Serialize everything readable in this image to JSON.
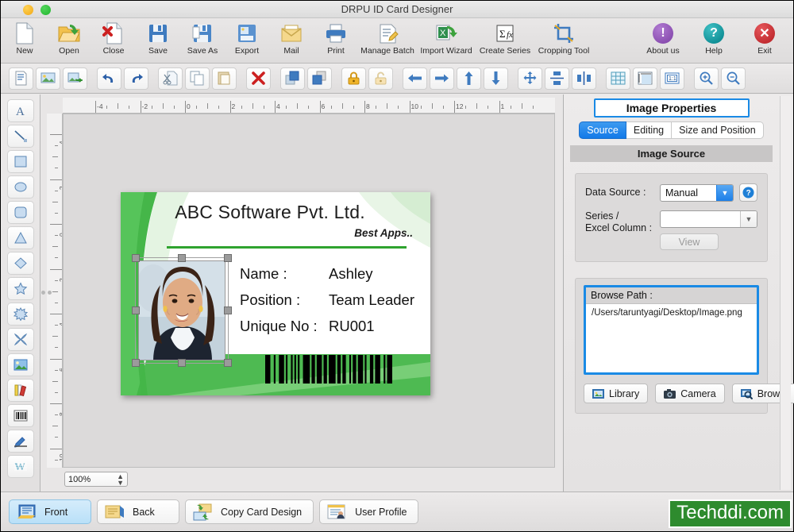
{
  "window": {
    "title": "DRPU ID Card Designer"
  },
  "main_toolbar": {
    "items": [
      {
        "label": "New",
        "icon": "new-document-icon"
      },
      {
        "label": "Open",
        "icon": "open-folder-icon"
      },
      {
        "label": "Close",
        "icon": "close-document-icon"
      },
      {
        "label": "Save",
        "icon": "save-disk-icon"
      },
      {
        "label": "Save As",
        "icon": "save-as-icon"
      },
      {
        "label": "Export",
        "icon": "export-icon"
      },
      {
        "label": "Mail",
        "icon": "mail-icon"
      },
      {
        "label": "Print",
        "icon": "printer-icon"
      },
      {
        "label": "Manage Batch",
        "icon": "manage-batch-icon"
      },
      {
        "label": "Import Wizard",
        "icon": "import-wizard-icon"
      },
      {
        "label": "Create Series",
        "icon": "create-series-icon"
      },
      {
        "label": "Cropping Tool",
        "icon": "cropping-tool-icon"
      }
    ],
    "right_items": [
      {
        "label": "About us",
        "icon": "info-circle-icon",
        "color": "#7d3fa5",
        "glyph": "!"
      },
      {
        "label": "Help",
        "icon": "help-circle-icon",
        "color": "#007e86",
        "glyph": "?"
      },
      {
        "label": "Exit",
        "icon": "exit-circle-icon",
        "color": "#b51d22",
        "glyph": "✕"
      }
    ]
  },
  "sub_toolbar": {
    "items": [
      "add-text-icon",
      "add-image-icon",
      "add-image-export-icon",
      "undo-icon",
      "redo-icon",
      "cut-icon",
      "copy-icon",
      "paste-icon",
      "delete-icon",
      "bring-to-front-icon",
      "send-to-back-icon",
      "lock-icon",
      "unlock-icon",
      "align-left-icon",
      "align-right-icon",
      "align-top-icon",
      "align-bottom-icon",
      "center-both-icon",
      "center-vertical-icon",
      "center-horizontal-icon",
      "grid-icon",
      "ruler-icon",
      "actual-size-icon",
      "zoom-in-icon",
      "zoom-out-icon"
    ]
  },
  "left_rail": {
    "tools": [
      "text-tool-icon",
      "line-tool-icon",
      "rectangle-tool-icon",
      "ellipse-tool-icon",
      "rounded-rectangle-tool-icon",
      "triangle-tool-icon",
      "diamond-tool-icon",
      "star-tool-icon",
      "burst-tool-icon",
      "four-point-star-tool-icon",
      "image-tool-icon",
      "signature-book-tool-icon",
      "barcode-tool-icon",
      "pen-tool-icon",
      "watermark-tool-icon"
    ]
  },
  "canvas": {
    "zoom_level": "100%",
    "ruler_h_labels": [
      "-4",
      "-2",
      "0",
      "2",
      "4",
      "6",
      "8",
      "10",
      "12",
      "1"
    ],
    "ruler_v_labels": [
      "-4",
      "-2",
      "0",
      "2",
      "4",
      "6",
      "8",
      "10"
    ]
  },
  "card": {
    "company_title": "ABC Software Pvt. Ltd.",
    "tagline": "Best Apps..",
    "fields": [
      {
        "label": "Name :",
        "value": "Ashley"
      },
      {
        "label": "Position :",
        "value": "Team Leader"
      },
      {
        "label": "Unique No :",
        "value": "RU001"
      }
    ],
    "accent_color": "#3eb23e",
    "barcode_pattern": [
      3,
      2,
      1,
      2,
      3,
      1,
      1,
      2,
      1,
      1,
      1,
      1,
      1,
      2,
      4,
      1,
      2,
      1,
      3,
      1,
      2,
      1,
      4,
      1,
      2,
      1,
      2,
      2,
      1,
      1,
      2,
      1,
      3,
      1,
      1,
      2,
      2,
      1,
      3,
      2,
      1,
      1,
      3
    ]
  },
  "right_panel": {
    "title": "Image Properties",
    "tabs": [
      {
        "label": "Source",
        "active": true
      },
      {
        "label": "Editing",
        "active": false
      },
      {
        "label": "Size and Position",
        "active": false
      }
    ],
    "section_header": "Image Source",
    "data_source_label": "Data Source :",
    "data_source_value": "Manual",
    "help_icon": "help-question-icon",
    "series_label_line1": "Series /",
    "series_label_line2": "Excel Column :",
    "series_value": "",
    "view_button": "View",
    "browse_path_label": "Browse Path :",
    "browse_path_value": "/Users/taruntyagi/Desktop/Image.png",
    "buttons": [
      {
        "label": "Library",
        "icon": "library-image-icon"
      },
      {
        "label": "Camera",
        "icon": "camera-icon"
      },
      {
        "label": "Browse",
        "icon": "browse-search-icon"
      }
    ],
    "highlight_color": "#1a8ae5"
  },
  "bottom_bar": {
    "buttons": [
      {
        "label": "Front",
        "icon": "card-front-icon",
        "active": true
      },
      {
        "label": "Back",
        "icon": "card-back-icon",
        "active": false
      },
      {
        "label": "Copy Card Design",
        "icon": "copy-card-design-icon",
        "active": false
      },
      {
        "label": "User Profile",
        "icon": "user-profile-icon",
        "active": false
      }
    ],
    "brand": "Techddi.com",
    "brand_color": "#2e8b2e"
  }
}
